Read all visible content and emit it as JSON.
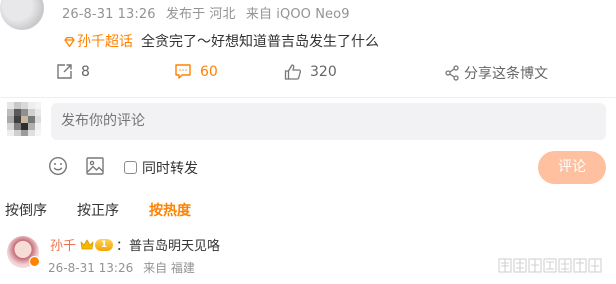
{
  "post": {
    "meta": {
      "date": "26-8-31 13:26",
      "published_at": "发布于 河北",
      "device": "来自 iQOO Neo9"
    },
    "topic": "孙千超话",
    "text": "全贪完了～好想知道普吉岛发生了什么",
    "actions": {
      "repost_count": "8",
      "comment_count": "60",
      "like_count": "320",
      "share_label": "分享这条博文"
    }
  },
  "composer": {
    "placeholder": "发布你的评论",
    "repost_label": "同时转发",
    "send_label": "评论"
  },
  "sort": {
    "reverse_label": "按倒序",
    "forward_label": "按正序",
    "hot_label": "按热度"
  },
  "reply": {
    "username": "孙千",
    "vip_level": "1",
    "text": "：普吉岛明天见咯",
    "date": "26-8-31 13:26",
    "source": "来自 福建"
  },
  "colors": {
    "accent": "#ff8200",
    "username": "#eb7350",
    "muted": "#939393",
    "send_button": "#ffc09f",
    "input_bg": "#f2f2f4"
  }
}
